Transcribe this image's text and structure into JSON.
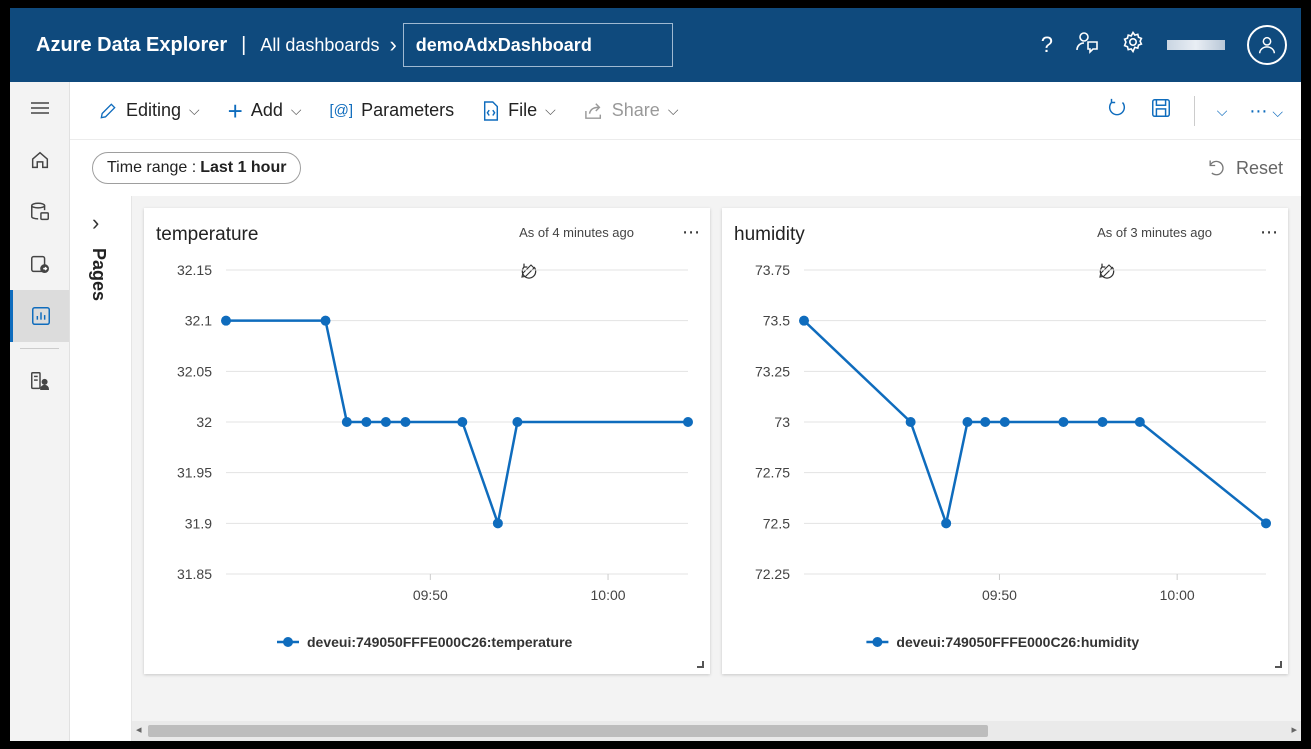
{
  "header": {
    "app_title": "Azure Data Explorer",
    "separator": "|",
    "all_dashboards": "All dashboards",
    "dashboard_name": "demoAdxDashboard"
  },
  "toolbar": {
    "editing": "Editing",
    "add": "Add",
    "parameters": "Parameters",
    "file": "File",
    "share": "Share"
  },
  "filters": {
    "time_range_prefix": "Time range :",
    "time_range_value": "Last 1 hour",
    "reset": "Reset"
  },
  "pages": {
    "label": "Pages"
  },
  "colors": {
    "accent": "#0f6cbd",
    "header": "#0f4a7d",
    "series": "#0f6cbd"
  },
  "tiles": [
    {
      "title": "temperature",
      "meta": "As of 4 minutes ago"
    },
    {
      "title": "humidity",
      "meta": "As of 3 minutes ago"
    }
  ],
  "chart_data": [
    {
      "type": "line",
      "title": "temperature",
      "x_ticks": [
        "09:50",
        "10:00"
      ],
      "x_tick_minutes": [
        50,
        60
      ],
      "xlim_minutes": [
        38.5,
        64.5
      ],
      "yticks": [
        32.15,
        32.1,
        32.05,
        32,
        31.95,
        31.9,
        31.85
      ],
      "ylim": [
        31.85,
        32.15
      ],
      "grid": true,
      "legend_position": "bottom",
      "series": [
        {
          "name": "deveui:749050FFFE000C26:temperature",
          "x_minutes": [
            38.5,
            44.1,
            45.3,
            46.4,
            47.5,
            48.6,
            51.8,
            53.8,
            54.9,
            64.5
          ],
          "values": [
            32.1,
            32.1,
            32,
            32,
            32,
            32,
            32,
            31.9,
            32,
            32
          ]
        }
      ]
    },
    {
      "type": "line",
      "title": "humidity",
      "x_ticks": [
        "09:50",
        "10:00"
      ],
      "x_tick_minutes": [
        50,
        60
      ],
      "xlim_minutes": [
        39.0,
        65.0
      ],
      "yticks": [
        73.75,
        73.5,
        73.25,
        73,
        72.75,
        72.5,
        72.25
      ],
      "ylim": [
        72.25,
        73.75
      ],
      "grid": true,
      "legend_position": "bottom",
      "series": [
        {
          "name": "deveui:749050FFFE000C26:humidity",
          "x_minutes": [
            39.0,
            45.0,
            47.0,
            48.2,
            49.2,
            50.3,
            53.6,
            55.8,
            57.9,
            65.0
          ],
          "values": [
            73.5,
            73,
            72.5,
            73,
            73,
            73,
            73,
            73,
            73,
            72.5
          ]
        }
      ]
    }
  ]
}
